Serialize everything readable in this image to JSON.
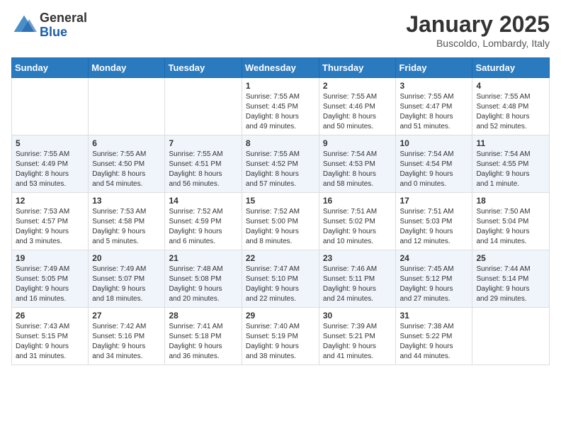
{
  "header": {
    "logo_general": "General",
    "logo_blue": "Blue",
    "month_title": "January 2025",
    "location": "Buscoldo, Lombardy, Italy"
  },
  "weekdays": [
    "Sunday",
    "Monday",
    "Tuesday",
    "Wednesday",
    "Thursday",
    "Friday",
    "Saturday"
  ],
  "weeks": [
    [
      {
        "day": "",
        "info": ""
      },
      {
        "day": "",
        "info": ""
      },
      {
        "day": "",
        "info": ""
      },
      {
        "day": "1",
        "info": "Sunrise: 7:55 AM\nSunset: 4:45 PM\nDaylight: 8 hours\nand 49 minutes."
      },
      {
        "day": "2",
        "info": "Sunrise: 7:55 AM\nSunset: 4:46 PM\nDaylight: 8 hours\nand 50 minutes."
      },
      {
        "day": "3",
        "info": "Sunrise: 7:55 AM\nSunset: 4:47 PM\nDaylight: 8 hours\nand 51 minutes."
      },
      {
        "day": "4",
        "info": "Sunrise: 7:55 AM\nSunset: 4:48 PM\nDaylight: 8 hours\nand 52 minutes."
      }
    ],
    [
      {
        "day": "5",
        "info": "Sunrise: 7:55 AM\nSunset: 4:49 PM\nDaylight: 8 hours\nand 53 minutes."
      },
      {
        "day": "6",
        "info": "Sunrise: 7:55 AM\nSunset: 4:50 PM\nDaylight: 8 hours\nand 54 minutes."
      },
      {
        "day": "7",
        "info": "Sunrise: 7:55 AM\nSunset: 4:51 PM\nDaylight: 8 hours\nand 56 minutes."
      },
      {
        "day": "8",
        "info": "Sunrise: 7:55 AM\nSunset: 4:52 PM\nDaylight: 8 hours\nand 57 minutes."
      },
      {
        "day": "9",
        "info": "Sunrise: 7:54 AM\nSunset: 4:53 PM\nDaylight: 8 hours\nand 58 minutes."
      },
      {
        "day": "10",
        "info": "Sunrise: 7:54 AM\nSunset: 4:54 PM\nDaylight: 9 hours\nand 0 minutes."
      },
      {
        "day": "11",
        "info": "Sunrise: 7:54 AM\nSunset: 4:55 PM\nDaylight: 9 hours\nand 1 minute."
      }
    ],
    [
      {
        "day": "12",
        "info": "Sunrise: 7:53 AM\nSunset: 4:57 PM\nDaylight: 9 hours\nand 3 minutes."
      },
      {
        "day": "13",
        "info": "Sunrise: 7:53 AM\nSunset: 4:58 PM\nDaylight: 9 hours\nand 5 minutes."
      },
      {
        "day": "14",
        "info": "Sunrise: 7:52 AM\nSunset: 4:59 PM\nDaylight: 9 hours\nand 6 minutes."
      },
      {
        "day": "15",
        "info": "Sunrise: 7:52 AM\nSunset: 5:00 PM\nDaylight: 9 hours\nand 8 minutes."
      },
      {
        "day": "16",
        "info": "Sunrise: 7:51 AM\nSunset: 5:02 PM\nDaylight: 9 hours\nand 10 minutes."
      },
      {
        "day": "17",
        "info": "Sunrise: 7:51 AM\nSunset: 5:03 PM\nDaylight: 9 hours\nand 12 minutes."
      },
      {
        "day": "18",
        "info": "Sunrise: 7:50 AM\nSunset: 5:04 PM\nDaylight: 9 hours\nand 14 minutes."
      }
    ],
    [
      {
        "day": "19",
        "info": "Sunrise: 7:49 AM\nSunset: 5:05 PM\nDaylight: 9 hours\nand 16 minutes."
      },
      {
        "day": "20",
        "info": "Sunrise: 7:49 AM\nSunset: 5:07 PM\nDaylight: 9 hours\nand 18 minutes."
      },
      {
        "day": "21",
        "info": "Sunrise: 7:48 AM\nSunset: 5:08 PM\nDaylight: 9 hours\nand 20 minutes."
      },
      {
        "day": "22",
        "info": "Sunrise: 7:47 AM\nSunset: 5:10 PM\nDaylight: 9 hours\nand 22 minutes."
      },
      {
        "day": "23",
        "info": "Sunrise: 7:46 AM\nSunset: 5:11 PM\nDaylight: 9 hours\nand 24 minutes."
      },
      {
        "day": "24",
        "info": "Sunrise: 7:45 AM\nSunset: 5:12 PM\nDaylight: 9 hours\nand 27 minutes."
      },
      {
        "day": "25",
        "info": "Sunrise: 7:44 AM\nSunset: 5:14 PM\nDaylight: 9 hours\nand 29 minutes."
      }
    ],
    [
      {
        "day": "26",
        "info": "Sunrise: 7:43 AM\nSunset: 5:15 PM\nDaylight: 9 hours\nand 31 minutes."
      },
      {
        "day": "27",
        "info": "Sunrise: 7:42 AM\nSunset: 5:16 PM\nDaylight: 9 hours\nand 34 minutes."
      },
      {
        "day": "28",
        "info": "Sunrise: 7:41 AM\nSunset: 5:18 PM\nDaylight: 9 hours\nand 36 minutes."
      },
      {
        "day": "29",
        "info": "Sunrise: 7:40 AM\nSunset: 5:19 PM\nDaylight: 9 hours\nand 38 minutes."
      },
      {
        "day": "30",
        "info": "Sunrise: 7:39 AM\nSunset: 5:21 PM\nDaylight: 9 hours\nand 41 minutes."
      },
      {
        "day": "31",
        "info": "Sunrise: 7:38 AM\nSunset: 5:22 PM\nDaylight: 9 hours\nand 44 minutes."
      },
      {
        "day": "",
        "info": ""
      }
    ]
  ]
}
